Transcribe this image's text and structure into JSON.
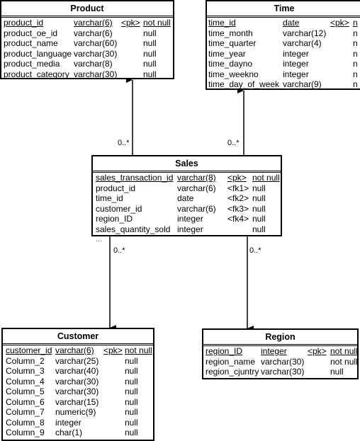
{
  "entities": [
    {
      "id": "product",
      "title": "Product",
      "columns": [
        [
          "product_id",
          "varchar(6)",
          "<pk>",
          "not null"
        ],
        [
          "product_oe_id",
          "varchar(6)",
          "",
          "null"
        ],
        [
          "product_name",
          "varchar(60)",
          "",
          "null"
        ],
        [
          "product_language",
          "varchar(30)",
          "",
          "null"
        ],
        [
          "product_media",
          "varchar(8)",
          "",
          "null"
        ],
        [
          "product_category",
          "varchar(30)",
          "",
          "null"
        ]
      ]
    },
    {
      "id": "time",
      "title": "Time",
      "columns": [
        [
          "time_id",
          "date",
          "<pk>",
          "n"
        ],
        [
          "time_month",
          "varchar(12)",
          "",
          "n"
        ],
        [
          "time_quarter",
          "varchar(4)",
          "",
          "n"
        ],
        [
          "time_year",
          "integer",
          "",
          "n"
        ],
        [
          "time_dayno",
          "integer",
          "",
          "n"
        ],
        [
          "time_weekno",
          "integer",
          "",
          "n"
        ],
        [
          "time_day_of_week",
          "varchar(9)",
          "",
          "n"
        ]
      ]
    },
    {
      "id": "sales",
      "title": "Sales",
      "columns": [
        [
          "sales_transaction_id",
          "varchar(8)",
          "<pk>",
          "not null"
        ],
        [
          "product_id",
          "varchar(6)",
          "<fk1>",
          "null"
        ],
        [
          "time_id",
          "date",
          "<fk2>",
          "null"
        ],
        [
          "customer_id",
          "varchar(6)",
          "<fk3>",
          "null"
        ],
        [
          "region_ID",
          "integer",
          "<fk4>",
          "null"
        ],
        [
          "sales_quantity_sold",
          "integer",
          "",
          "null"
        ]
      ]
    },
    {
      "id": "customer",
      "title": "Customer",
      "columns": [
        [
          "customer_id",
          "varchar(6)",
          "<pk>",
          "not null"
        ],
        [
          "Column_2",
          "varchar(25)",
          "",
          "null"
        ],
        [
          "Column_3",
          "varchar(40)",
          "",
          "null"
        ],
        [
          "Column_4",
          "varchar(30)",
          "",
          "null"
        ],
        [
          "Column_5",
          "varchar(30)",
          "",
          "null"
        ],
        [
          "Column_6",
          "varchar(15)",
          "",
          "null"
        ],
        [
          "Column_7",
          "numeric(9)",
          "",
          "null"
        ],
        [
          "Column_8",
          "integer",
          "",
          "null"
        ],
        [
          "Column_9",
          "char(1)",
          "",
          "null"
        ]
      ]
    },
    {
      "id": "region",
      "title": "Region",
      "columns": [
        [
          "region_ID",
          "integer",
          "<pk>",
          "not null"
        ],
        [
          "region_name",
          "varchar(30)",
          "",
          "not null"
        ],
        [
          "region_cjuntry",
          "varchar(30)",
          "",
          "null"
        ]
      ]
    }
  ],
  "relations": [
    {
      "from": "sales",
      "to": "product",
      "cardinality": "0..*"
    },
    {
      "from": "sales",
      "to": "time",
      "cardinality": "0..*"
    },
    {
      "from": "sales",
      "to": "customer",
      "cardinality": "0..*"
    },
    {
      "from": "sales",
      "to": "region",
      "cardinality": "0..*"
    }
  ],
  "sales_more": "..."
}
